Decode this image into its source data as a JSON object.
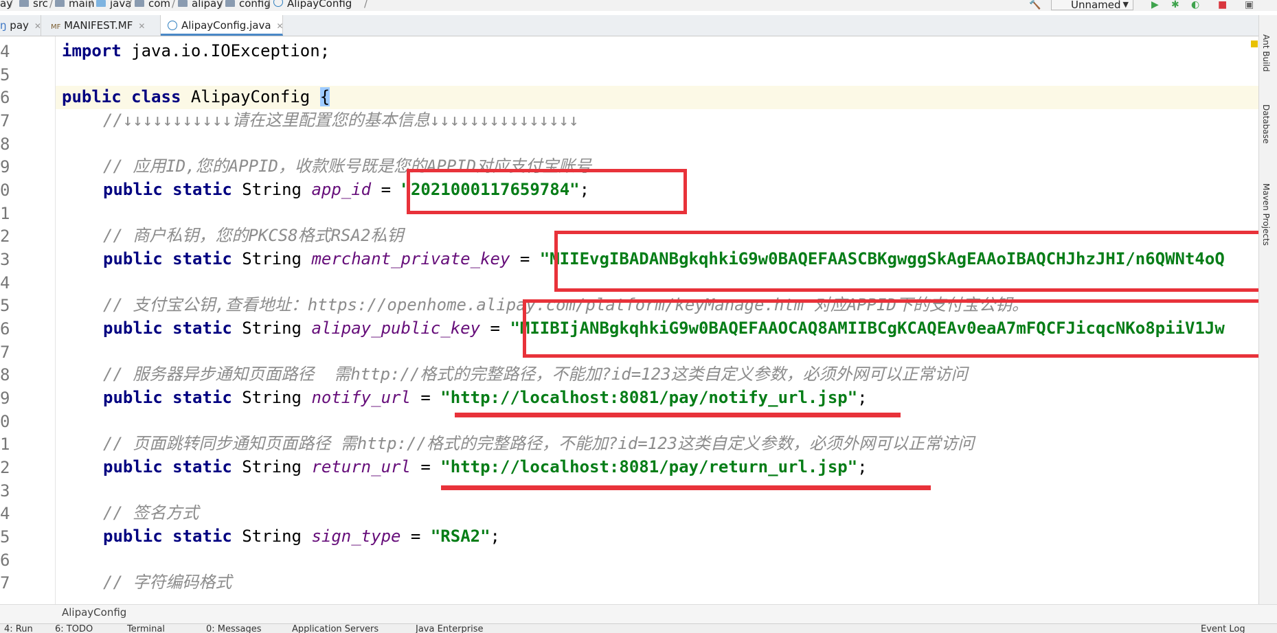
{
  "breadcrumb": [
    "ay",
    "src",
    "main",
    "java",
    "com",
    "config",
    "alipay",
    "AlipayConfig"
  ],
  "toolbar": {
    "run_config": "Unnamed"
  },
  "tabs": [
    {
      "label": "pay",
      "active": false
    },
    {
      "label": "MANIFEST.MF",
      "active": false
    },
    {
      "label": "AlipayConfig.java",
      "active": true
    }
  ],
  "line_numbers": [
    "4",
    "5",
    "6",
    "7",
    "8",
    "9",
    "0",
    "1",
    "2",
    "3",
    "4",
    "5",
    "6",
    "7",
    "8",
    "9",
    "0",
    "1",
    "2",
    "3",
    "4",
    "5",
    "6",
    "7"
  ],
  "code": {
    "import": {
      "kw": "import",
      "rest": " java.io.IOException;"
    },
    "class_decl": {
      "kw": "public class",
      "name": " AlipayConfig ",
      "brace": "{"
    },
    "comment_header": "//↓↓↓↓↓↓↓↓↓↓↓请在这里配置您的基本信息↓↓↓↓↓↓↓↓↓↓↓↓↓↓↓",
    "comment_appid": "// 应用ID,您的APPID，收款账号既是您的APPID对应支付宝账号",
    "app_id": {
      "kw": "public static",
      "type": " String ",
      "name": "app_id",
      "eq": " = ",
      "value": "\"2021000117659784\"",
      "end": ";"
    },
    "comment_private": "// 商户私钥，您的PKCS8格式RSA2私钥",
    "merchant_private_key": {
      "kw": "public static",
      "type": " String ",
      "name": "merchant_private_key",
      "eq": " = ",
      "value": "\"MIIEvgIBADANBgkqhkiG9w0BAQEFAASCBKgwggSkAgEAAoIBAQCHJhzJHI/n6QWNt4oQ"
    },
    "comment_public": "// 支付宝公钥,查看地址：https://openhome.alipay.com/platform/keyManage.htm 对应APPID下的支付宝公钥。",
    "alipay_public_key": {
      "kw": "public static",
      "type": " String ",
      "name": "alipay_public_key",
      "eq": " = ",
      "value": "\"MIIBIjANBgkqhkiG9w0BAQEFAAOCAQ8AMIIBCgKCAQEAv0eaA7mFQCFJicqcNKo8piiV1Jw"
    },
    "comment_notify": "// 服务器异步通知页面路径  需http://格式的完整路径，不能加?id=123这类自定义参数，必须外网可以正常访问",
    "notify_url": {
      "kw": "public static",
      "type": " String ",
      "name": "notify_url",
      "eq": " = ",
      "value": "\"http://localhost:8081/pay/notify_url.jsp\"",
      "end": ";"
    },
    "comment_return": "// 页面跳转同步通知页面路径 需http://格式的完整路径，不能加?id=123这类自定义参数，必须外网可以正常访问",
    "return_url": {
      "kw": "public static",
      "type": " String ",
      "name": "return_url",
      "eq": " = ",
      "value": "\"http://localhost:8081/pay/return_url.jsp\"",
      "end": ";"
    },
    "comment_sign": "// 签名方式",
    "sign_type": {
      "kw": "public static",
      "type": " String ",
      "name": "sign_type",
      "eq": " = ",
      "value": "\"RSA2\"",
      "end": ";"
    },
    "comment_charset": "// 字符编码格式"
  },
  "right_tabs": [
    "Ant Build",
    "Database",
    "Maven Projects"
  ],
  "footer_crumb": "AlipayConfig",
  "status_items": [
    "4: Run",
    "6: TODO",
    "Terminal",
    "0: Messages",
    "Application Servers",
    "Java Enterprise",
    "Event Log"
  ],
  "colors": {
    "highlight": "#e8323a",
    "keyword": "#000080",
    "string": "#067d17",
    "field": "#660e7a",
    "comment": "#8c8c8c"
  }
}
